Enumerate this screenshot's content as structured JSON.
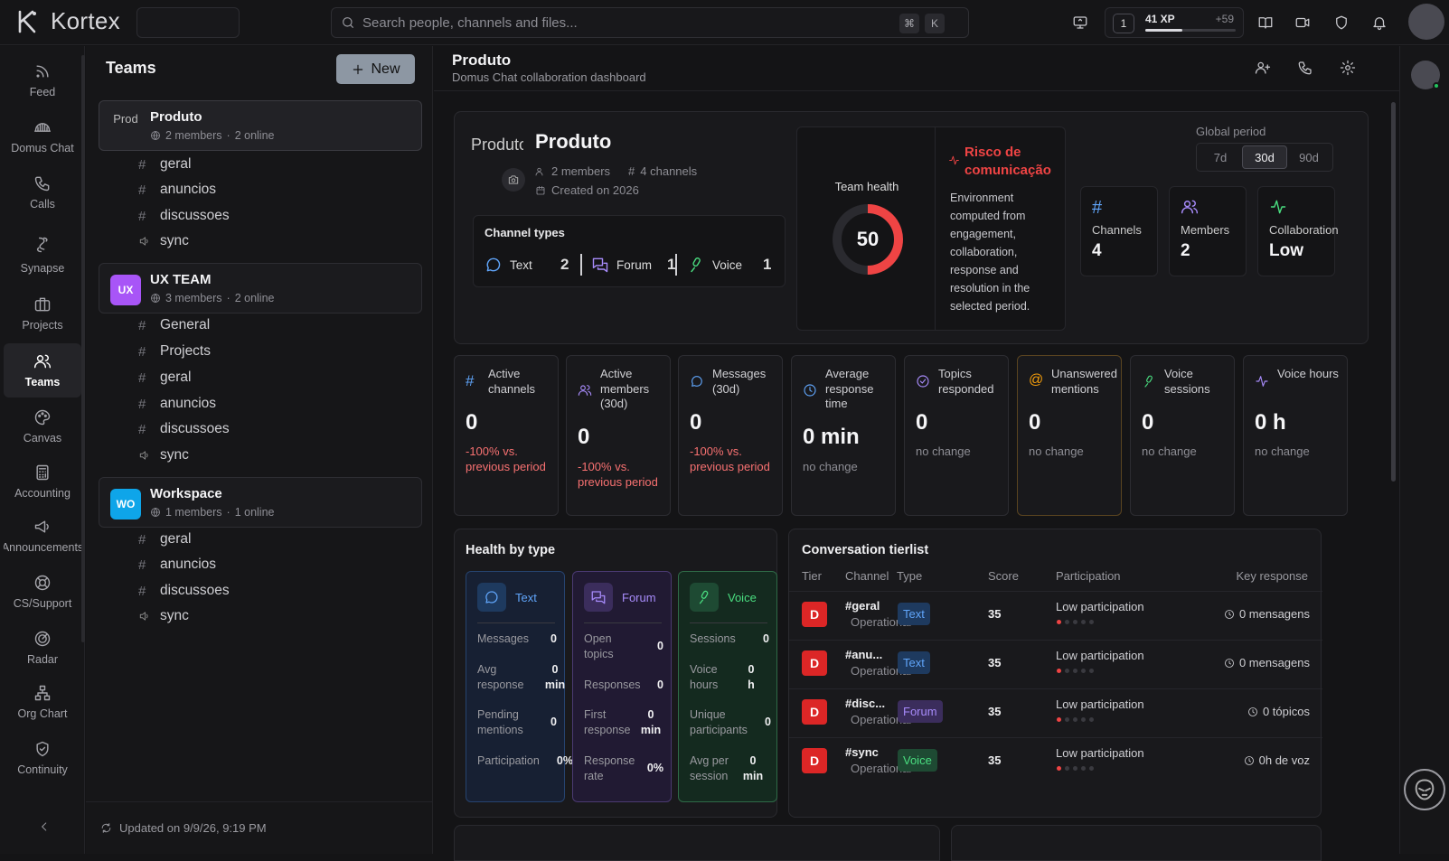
{
  "app": {
    "name": "Kortex"
  },
  "search": {
    "placeholder": "Search people, channels and files...",
    "kbd1": "⌘",
    "kbd2": "K"
  },
  "xp": {
    "level": "1",
    "label": "41 XP",
    "delta": "+59",
    "progress": 0.41
  },
  "rail": {
    "items": [
      {
        "label": "Feed"
      },
      {
        "label": "Domus Chat"
      },
      {
        "label": "Calls"
      },
      {
        "label": "Synapse"
      },
      {
        "label": "Projects"
      },
      {
        "label": "Teams"
      },
      {
        "label": "Canvas"
      },
      {
        "label": "Accounting"
      },
      {
        "label": "Announcements"
      },
      {
        "label": "CS/Support"
      },
      {
        "label": "Radar"
      },
      {
        "label": "Org Chart"
      },
      {
        "label": "Continuity"
      }
    ]
  },
  "teams": {
    "title": "Teams",
    "new_label": "New",
    "list": [
      {
        "name": "Produto",
        "avatar": "Prod",
        "members": "2 members",
        "online": "2 online",
        "channels": [
          "geral",
          "anuncios",
          "discussoes"
        ],
        "voice": "sync"
      },
      {
        "name": "UX TEAM",
        "avatar": "UX",
        "members": "3 members",
        "online": "2 online",
        "channels": [
          "General",
          "Projects",
          "geral",
          "anuncios",
          "discussoes"
        ],
        "voice": "sync"
      },
      {
        "name": "Workspace",
        "avatar": "WO",
        "members": "1 members",
        "online": "1 online",
        "channels": [
          "geral",
          "anuncios",
          "discussoes"
        ],
        "voice": "sync"
      }
    ],
    "updated": "Updated on 9/9/26, 9:19 PM"
  },
  "header": {
    "title": "Produto",
    "subtitle": "Domus Chat collaboration dashboard"
  },
  "overview": {
    "avatar_alt": "Produto",
    "name": "Produto",
    "members": "2 members",
    "channels": "4 channels",
    "created": "Created on 2026",
    "channel_types": {
      "title": "Channel types",
      "items": [
        {
          "label": "Text",
          "count": "2"
        },
        {
          "label": "Forum",
          "count": "1"
        },
        {
          "label": "Voice",
          "count": "1"
        }
      ]
    },
    "health": {
      "label": "Team health",
      "value": "50",
      "fraction": 0.5
    },
    "risk": {
      "title": "Risco de comunicação",
      "description": "Environment computed from engagement, collaboration, response and resolution in the selected period."
    },
    "period": {
      "label": "Global period",
      "options": [
        "7d",
        "30d",
        "90d"
      ],
      "selected": "30d"
    },
    "kpis": [
      {
        "label": "Channels",
        "value": "4"
      },
      {
        "label": "Members",
        "value": "2"
      },
      {
        "label": "Collaboration",
        "value": "Low"
      }
    ]
  },
  "metrics": [
    {
      "label": "Active channels",
      "value": "0",
      "delta": "-100% vs. previous period",
      "tone": "neg"
    },
    {
      "label": "Active members (30d)",
      "value": "0",
      "delta": "-100% vs. previous period",
      "tone": "neg"
    },
    {
      "label": "Messages (30d)",
      "value": "0",
      "delta": "-100% vs. previous period",
      "tone": "neg"
    },
    {
      "label": "Average response time",
      "value": "0 min",
      "delta": "no change",
      "tone": "neutral"
    },
    {
      "label": "Topics responded",
      "value": "0",
      "delta": "no change",
      "tone": "neutral"
    },
    {
      "label": "Unanswered mentions",
      "value": "0",
      "delta": "no change",
      "tone": "neutral"
    },
    {
      "label": "Voice sessions",
      "value": "0",
      "delta": "no change",
      "tone": "neutral"
    },
    {
      "label": "Voice hours",
      "value": "0 h",
      "delta": "no change",
      "tone": "neutral"
    }
  ],
  "health_by_type": {
    "title": "Health by type",
    "columns": [
      {
        "label": "Text",
        "rows": [
          {
            "k": "Messages",
            "v": "0"
          },
          {
            "k": "Avg response",
            "v": "0 min"
          },
          {
            "k": "Pending mentions",
            "v": "0"
          },
          {
            "k": "Participation",
            "v": "0%"
          }
        ]
      },
      {
        "label": "Forum",
        "rows": [
          {
            "k": "Open topics",
            "v": "0"
          },
          {
            "k": "Responses",
            "v": "0"
          },
          {
            "k": "First response",
            "v": "0 min"
          },
          {
            "k": "Response rate",
            "v": "0%"
          }
        ]
      },
      {
        "label": "Voice",
        "rows": [
          {
            "k": "Sessions",
            "v": "0"
          },
          {
            "k": "Voice hours",
            "v": "0 h"
          },
          {
            "k": "Unique participants",
            "v": "0"
          },
          {
            "k": "Avg per session",
            "v": "0 min"
          }
        ]
      }
    ]
  },
  "tierlist": {
    "title": "Conversation tierlist",
    "headers": {
      "tier": "Tier",
      "channel": "Channel",
      "type": "Type",
      "score": "Score",
      "participation": "Participation",
      "key": "Key response"
    },
    "rows": [
      {
        "tier": "D",
        "channel": "#geral",
        "status": "Operational",
        "type": "Text",
        "score": "35",
        "participation": "Low participation",
        "key": "0 mensagens"
      },
      {
        "tier": "D",
        "channel": "#anu...",
        "status": "Operational",
        "type": "Text",
        "score": "35",
        "participation": "Low participation",
        "key": "0 mensagens"
      },
      {
        "tier": "D",
        "channel": "#disc...",
        "status": "Operational",
        "type": "Forum",
        "score": "35",
        "participation": "Low participation",
        "key": "0 tópicos"
      },
      {
        "tier": "D",
        "channel": "#sync",
        "status": "Operational",
        "type": "Voice",
        "score": "35",
        "participation": "Low participation",
        "key": "0h de voz"
      }
    ]
  },
  "colors": {
    "accent_red": "#ef4444",
    "text_blue": "#60a5fa",
    "forum_purple": "#a78bfa",
    "voice_green": "#4ade80",
    "mention_amber": "#f59e0b"
  }
}
